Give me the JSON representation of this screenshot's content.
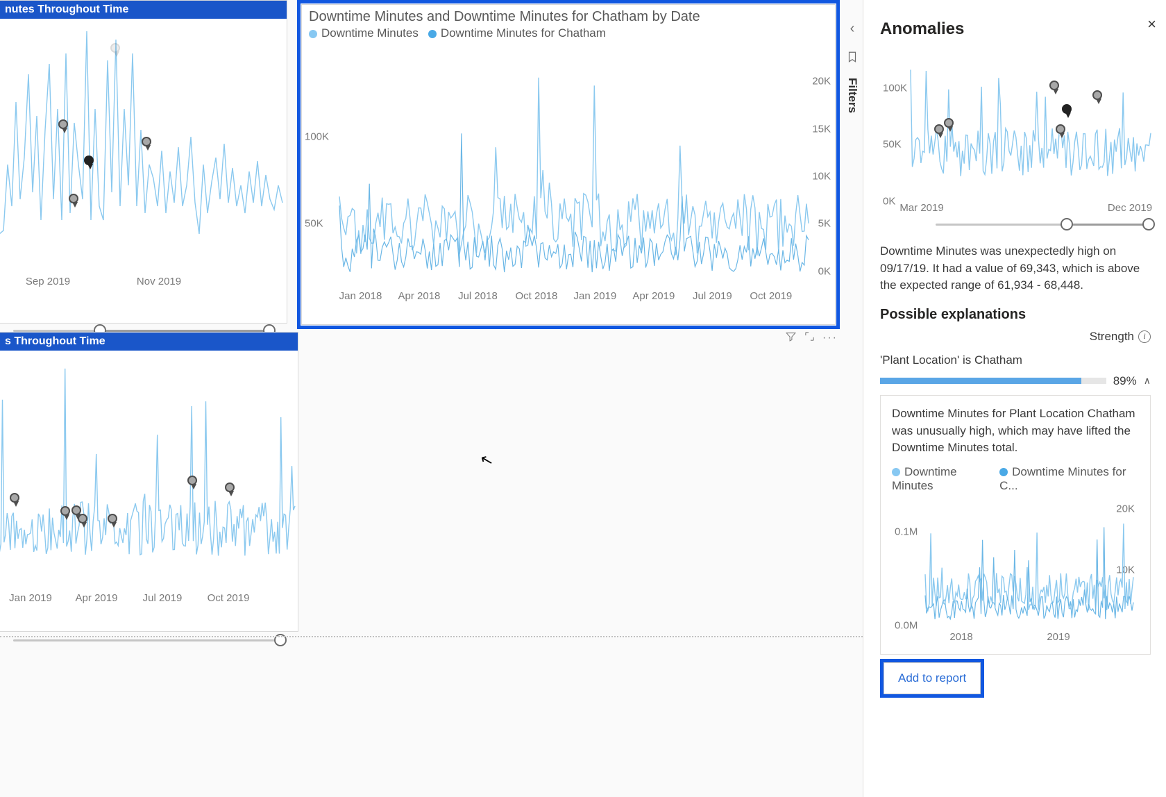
{
  "panel": {
    "title": "Anomalies",
    "summary": "Downtime Minutes was unexpectedly high on 09/17/19. It had a value of 69,343, which is above the expected range of 61,934 - 68,448.",
    "possible_heading": "Possible explanations",
    "strength_label": "Strength",
    "exp1_name": "'Plant Location' is Chatham",
    "exp1_pct": "89%",
    "card_text": "Downtime Minutes for Plant Location Chatham was unusually high, which may have lifted the Downtime Minutes total.",
    "legend_a": "Downtime Minutes",
    "legend_b": "Downtime Minutes for C...",
    "add_label": "Add to report",
    "mini1_yticks": [
      "100K",
      "50K",
      "0K"
    ],
    "mini1_xticks": [
      "Mar 2019",
      "Dec 2019"
    ],
    "mini2_yl": [
      "0.1M",
      "0.0M"
    ],
    "mini2_yr": [
      "20K",
      "10K"
    ],
    "mini2_x": [
      "2018",
      "2019"
    ]
  },
  "side": {
    "filters": "Filters"
  },
  "tile_a": {
    "title": "nutes Throughout Time",
    "xticks": [
      "Sep 2019",
      "Nov 2019"
    ]
  },
  "tile_b": {
    "title": "Downtime Minutes and Downtime Minutes for Chatham by Date",
    "legend_a": "Downtime Minutes",
    "legend_b": "Downtime Minutes for Chatham",
    "yl": [
      "100K",
      "50K"
    ],
    "yr": [
      "20K",
      "15K",
      "10K",
      "5K",
      "0K"
    ],
    "xticks": [
      "Jan 2018",
      "Apr 2018",
      "Jul 2018",
      "Oct 2018",
      "Jan 2019",
      "Apr 2019",
      "Jul 2019",
      "Oct 2019"
    ]
  },
  "tile_c": {
    "title": "s Throughout Time",
    "xticks": [
      "Jan 2019",
      "Apr 2019",
      "Jul 2019",
      "Oct 2019"
    ]
  },
  "chart_data": [
    {
      "type": "line",
      "title": "nutes Throughout Time",
      "xlabel": "",
      "ylabel": "",
      "x_range": [
        "2019-08",
        "2020-01"
      ],
      "series": [
        {
          "name": "Downtime Minutes",
          "approx": "dense daily values ~15K–110K, spikes mid-Oct"
        }
      ],
      "anomalies": [
        {
          "date": "Sep 2019",
          "value": 75000
        },
        {
          "date": "Sep 2019",
          "value": 55000
        },
        {
          "date": "late Sep 2019",
          "value": 69000,
          "selected": true
        },
        {
          "date": "Oct 2019",
          "value": 80000
        },
        {
          "date": "Oct 2019",
          "value": 95000
        }
      ]
    },
    {
      "type": "line",
      "title": "Downtime Minutes and Downtime Minutes for Chatham by Date",
      "xlabel": "Date",
      "ylabel_left": "Downtime Minutes",
      "ylabel_right": "Downtime Minutes for Chatham",
      "x_range": [
        "2018-01",
        "2019-12"
      ],
      "yl_range": [
        0,
        120000
      ],
      "yr_range": [
        0,
        20000
      ],
      "series": [
        {
          "name": "Downtime Minutes",
          "axis": "left",
          "approx": "noisy ~15K–70K, spikes to ~110K late 2019"
        },
        {
          "name": "Downtime Minutes for Chatham",
          "axis": "right",
          "approx": "noisy ~1K–8K, spike to ~18K late 2019"
        }
      ]
    },
    {
      "type": "line",
      "title": "s Throughout Time",
      "x_range": [
        "2019-01",
        "2019-12"
      ],
      "series": [
        {
          "name": "Downtime Minutes"
        }
      ],
      "anomalies_count": 8
    },
    {
      "type": "line",
      "title": "Anomalies panel mini chart",
      "x_range": [
        "2019-03",
        "2019-12"
      ],
      "y_range": [
        0,
        110000
      ],
      "series": [
        {
          "name": "Downtime Minutes"
        }
      ],
      "anomalies": [
        {
          "approx_date": "Apr 2019",
          "value": 55000
        },
        {
          "approx_date": "Apr 2019",
          "value": 60000
        },
        {
          "approx_date": "Sep 2019",
          "value": 95000
        },
        {
          "approx_date": "Sep 2019",
          "value": 69343,
          "selected": true
        },
        {
          "approx_date": "Sep 2019",
          "value": 60000
        },
        {
          "approx_date": "Oct 2019",
          "value": 88000
        }
      ]
    },
    {
      "type": "line",
      "title": "Explanation card mini chart",
      "x_range": [
        "2018-01",
        "2019-12"
      ],
      "yl_range": [
        0,
        100000
      ],
      "yr_range": [
        0,
        20000
      ],
      "series": [
        {
          "name": "Downtime Minutes",
          "axis": "left"
        },
        {
          "name": "Downtime Minutes for Chatham",
          "axis": "right"
        }
      ]
    }
  ]
}
